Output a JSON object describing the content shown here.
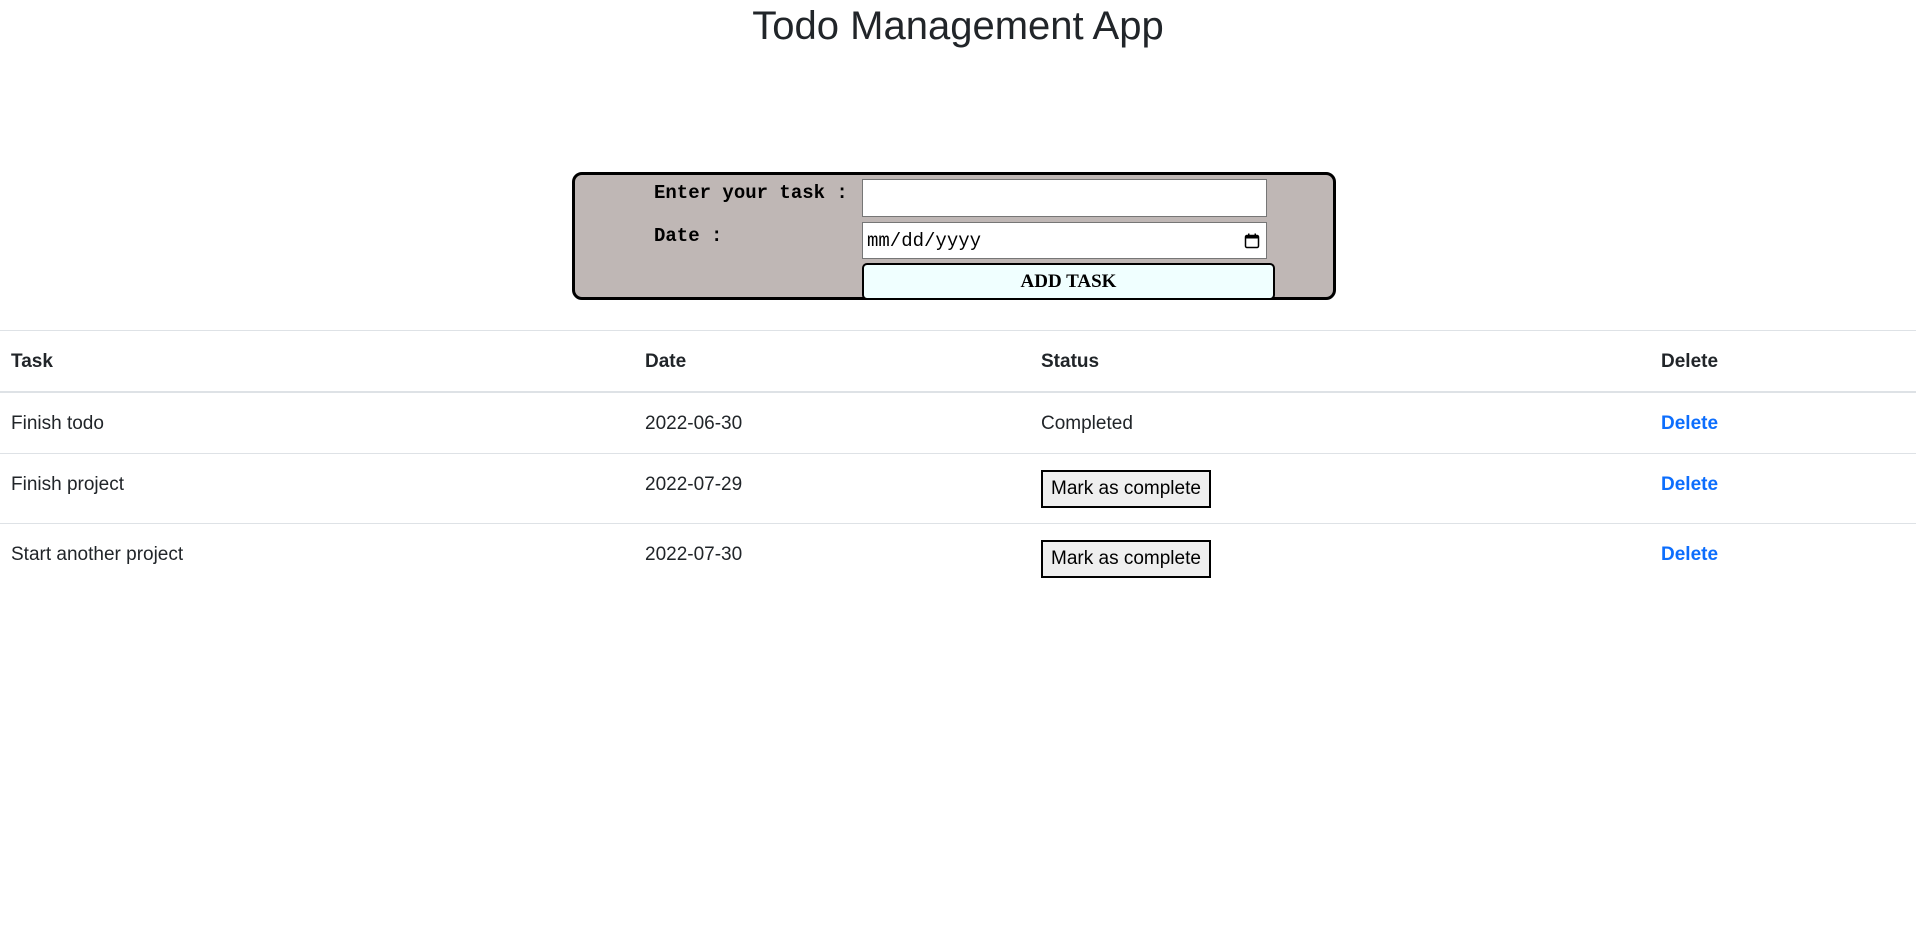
{
  "app": {
    "title": "Todo Management App"
  },
  "form": {
    "task_label": "Enter your task :",
    "task_value": "",
    "date_label": "Date :",
    "date_placeholder": "mm/dd/yyyy",
    "add_button_label": "ADD TASK",
    "background_color": "#bfb7b5",
    "button_color": "#f0ffff"
  },
  "table": {
    "headers": {
      "task": "Task",
      "date": "Date",
      "status": "Status",
      "delete": "Delete"
    },
    "rows": [
      {
        "task": "Finish todo",
        "date": "2022-06-30",
        "status": "Completed",
        "delete_label": "Delete"
      },
      {
        "task": "Finish project",
        "date": "2022-07-29",
        "status": "Mark as complete",
        "delete_label": "Delete"
      },
      {
        "task": "Start another project",
        "date": "2022-07-30",
        "status": "Mark as complete",
        "delete_label": "Delete"
      }
    ]
  },
  "colors": {
    "link": "#0d6efd",
    "text": "#212529"
  },
  "icons": {
    "date_picker": "calendar-icon"
  }
}
